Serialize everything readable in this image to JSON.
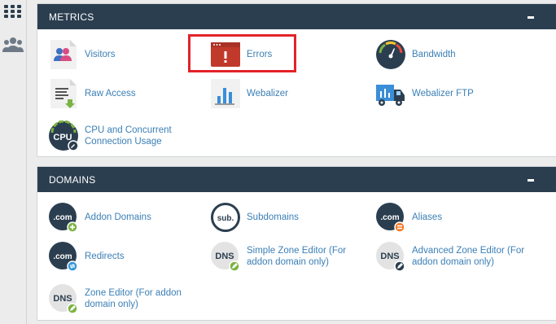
{
  "metrics": {
    "title": "METRICS",
    "items": [
      {
        "label": "Visitors",
        "icon": "visitors-icon"
      },
      {
        "label": "Errors",
        "icon": "errors-icon"
      },
      {
        "label": "Bandwidth",
        "icon": "bandwidth-icon"
      },
      {
        "label": "Raw Access",
        "icon": "raw-access-icon"
      },
      {
        "label": "Webalizer",
        "icon": "webalizer-icon"
      },
      {
        "label": "Webalizer FTP",
        "icon": "webalizer-ftp-icon"
      },
      {
        "label": "CPU and Concurrent Connection Usage",
        "icon": "cpu-icon",
        "icon_text": "CPU"
      }
    ]
  },
  "domains": {
    "title": "DOMAINS",
    "items": [
      {
        "label": "Addon Domains",
        "icon": "addon-domains-icon",
        "icon_text": ".com"
      },
      {
        "label": "Subdomains",
        "icon": "subdomains-icon",
        "icon_text": "sub."
      },
      {
        "label": "Aliases",
        "icon": "aliases-icon",
        "icon_text": ".com"
      },
      {
        "label": "Redirects",
        "icon": "redirects-icon",
        "icon_text": ".com"
      },
      {
        "label": "Simple Zone Editor (For addon domain only)",
        "icon": "simple-zone-editor-icon",
        "icon_text": "DNS"
      },
      {
        "label": "Advanced Zone Editor (For addon domain only)",
        "icon": "advanced-zone-editor-icon",
        "icon_text": "DNS"
      },
      {
        "label": "Zone Editor (For addon domain only)",
        "icon": "zone-editor-icon",
        "icon_text": "DNS"
      }
    ]
  },
  "sidebar": {
    "items": [
      {
        "icon": "grid-icon"
      },
      {
        "icon": "users-icon"
      }
    ]
  },
  "colors": {
    "header_bg": "#2b3e4f",
    "link": "#3b7fb6",
    "highlight": "#e2232a",
    "dark_icon": "#2b3e4f",
    "green_badge": "#7cb342",
    "orange_badge": "#f57c2b",
    "blue_badge": "#2f95d8"
  }
}
